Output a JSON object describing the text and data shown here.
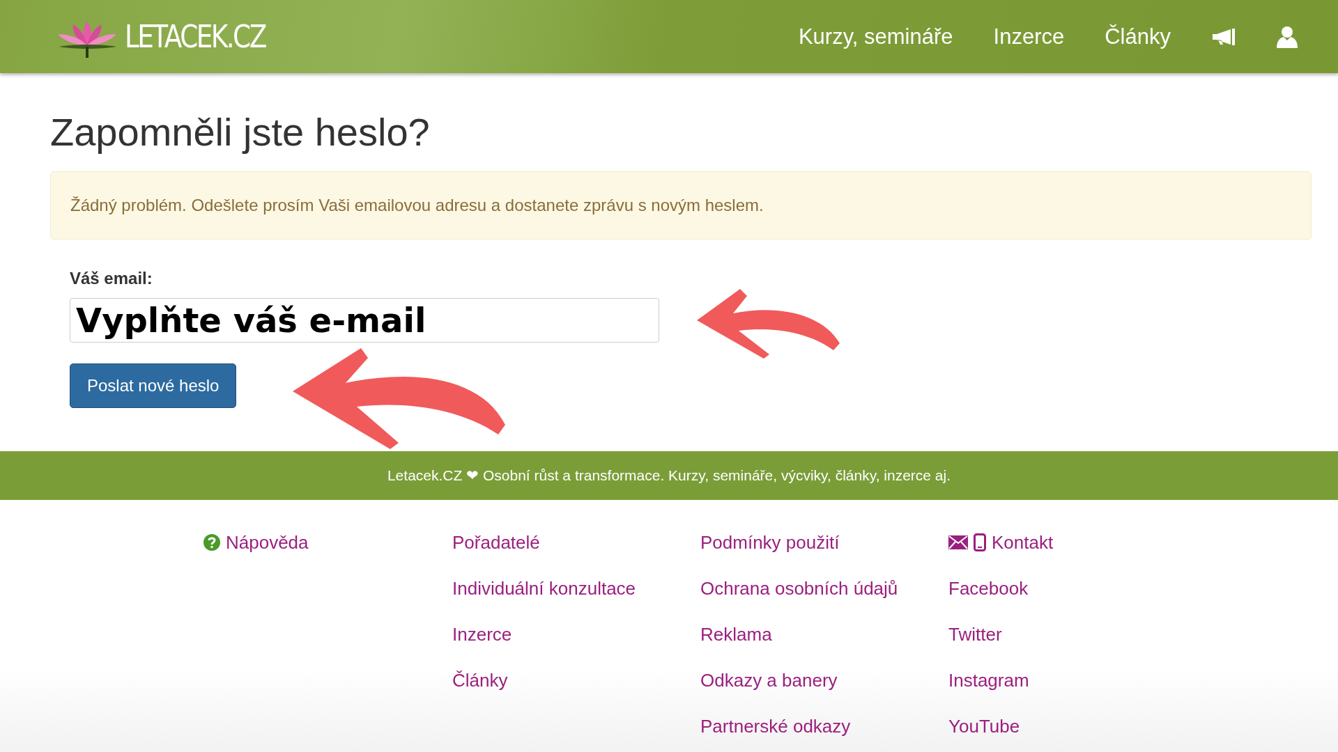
{
  "header": {
    "logo_text": "LETACEK.CZ",
    "nav": [
      "Kurzy, semináře",
      "Inzerce",
      "Články"
    ]
  },
  "title": "Zapomněli jste heslo?",
  "alert": "Žádný problém. Odešlete prosím Vaši emailovou adresu a dostanete zprávu s novým heslem.",
  "form": {
    "label": "Váš email:",
    "value": "Vyplňte váš e-mail",
    "button": "Poslat nové heslo"
  },
  "footer": {
    "tagline": "Letacek.CZ ❤ Osobní růst a transformace. Kurzy, semináře, výcviky, články, inzerce aj.",
    "columns": [
      [
        {
          "label": "Nápověda",
          "kind": "help"
        }
      ],
      [
        {
          "label": "Pořadatelé",
          "kind": "link"
        },
        {
          "label": "Individuální konzultace",
          "kind": "link"
        },
        {
          "label": "Inzerce",
          "kind": "link"
        },
        {
          "label": "Články",
          "kind": "link"
        }
      ],
      [
        {
          "label": "Podmínky použití",
          "kind": "link"
        },
        {
          "label": "Ochrana osobních údajů",
          "kind": "link"
        },
        {
          "label": "Reklama",
          "kind": "link"
        },
        {
          "label": "Odkazy a banery",
          "kind": "link"
        },
        {
          "label": "Partnerské odkazy",
          "kind": "link"
        }
      ],
      [
        {
          "label": "Kontakt",
          "kind": "contact"
        },
        {
          "label": "Facebook",
          "kind": "link"
        },
        {
          "label": "Twitter",
          "kind": "link"
        },
        {
          "label": "Instagram",
          "kind": "link"
        },
        {
          "label": "YouTube",
          "kind": "link"
        }
      ]
    ]
  }
}
